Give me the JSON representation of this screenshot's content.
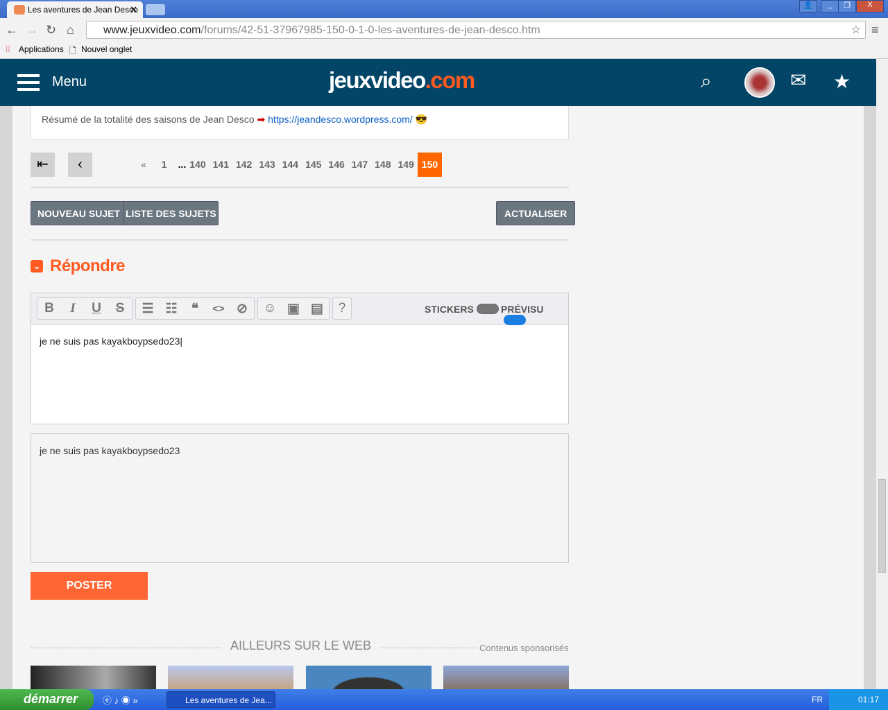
{
  "browser": {
    "tab_title": "Les aventures de Jean Desco",
    "url_host": "www.jeuxvideo.com",
    "url_path": "/forums/42-51-37967985-150-0-1-0-les-aventures-de-jean-desco.htm",
    "bookmarks": [
      "Applications",
      "Nouvel onglet"
    ]
  },
  "header": {
    "menu_label": "Menu",
    "logo_main": "jeuxvideo",
    "logo_tld": ".com"
  },
  "signature": {
    "text": "Résumé de la totalité des saisons de Jean Desco",
    "link": "https://jeandesco.wordpress.com/"
  },
  "pagination": {
    "prev_label": "«",
    "pages": [
      "1",
      "...",
      "140",
      "141",
      "142",
      "143",
      "144",
      "145",
      "146",
      "147",
      "148",
      "149"
    ],
    "current": "150"
  },
  "actions": {
    "new_topic": "NOUVEAU SUJET",
    "topic_list": "LISTE DES SUJETS",
    "refresh": "ACTUALISER"
  },
  "reply": {
    "title": "Répondre",
    "stickers_label": "STICKERS",
    "preview_label": "PRÉVISU",
    "message": "je ne suis pas kayakboypsedo23",
    "preview_text": "je ne suis pas kayakboypsedo23",
    "post_label": "POSTER"
  },
  "elsewhere": {
    "title": "AILLEURS SUR LE WEB",
    "sponsored": "Contenus sponsorisés"
  },
  "taskbar": {
    "start": "démarrer",
    "task": "Les aventures de Jea...",
    "lang": "FR",
    "time": "01:17"
  }
}
